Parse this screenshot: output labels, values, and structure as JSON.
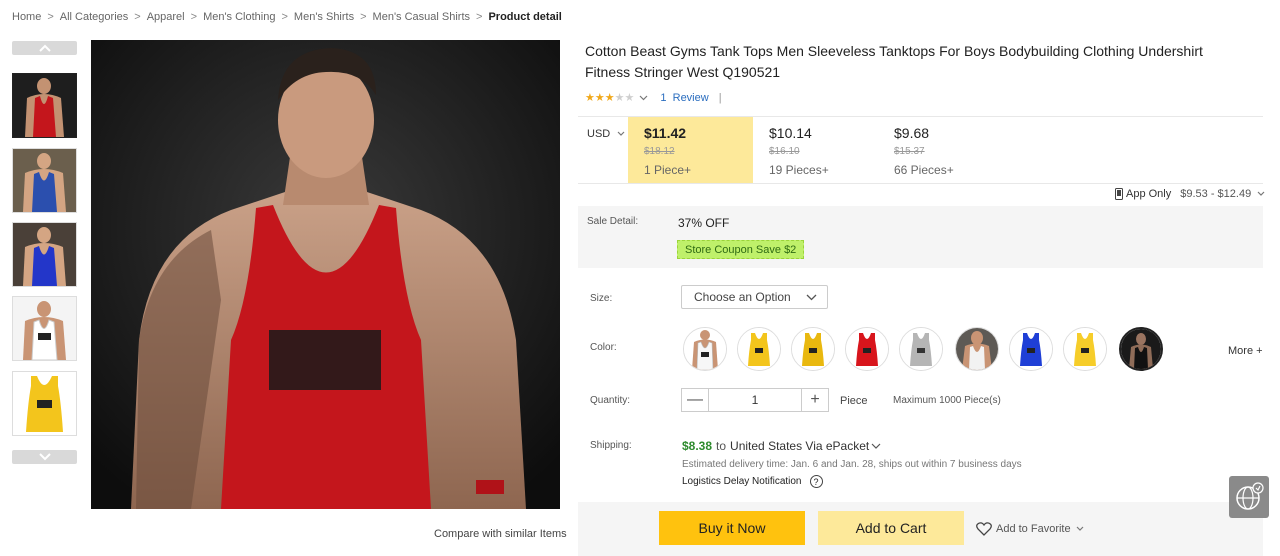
{
  "breadcrumb": [
    "Home",
    "All Categories",
    "Apparel",
    "Men's Clothing",
    "Men's Shirts",
    "Men's Casual Shirts",
    "Product detail"
  ],
  "breadcrumb_separator": ">",
  "product": {
    "title": "Cotton Beast Gyms Tank Tops Men Sleeveless Tanktops For Boys Bodybuilding Clothing Undershirt Fitness Stringer West Q190521",
    "rating_stars": 3,
    "rating_max": 5,
    "review_count": "1",
    "review_label": "Review",
    "rating_divider": "|"
  },
  "pricing": {
    "currency": "USD",
    "tiers": [
      {
        "price": "$11.42",
        "original": "$18.12",
        "quantity": "1 Piece+",
        "active": true
      },
      {
        "price": "$10.14",
        "original": "$16.10",
        "quantity": "19 Pieces+",
        "active": false
      },
      {
        "price": "$9.68",
        "original": "$15.37",
        "quantity": "66 Pieces+",
        "active": false
      }
    ],
    "app_only_label": "App Only",
    "app_only_range": "$9.53 - $12.49"
  },
  "sale": {
    "label": "Sale Detail:",
    "discount": "37% OFF",
    "coupon": "Store Coupon Save $2"
  },
  "options": {
    "size_label": "Size:",
    "size_placeholder": "Choose an Option",
    "color_label": "Color:",
    "more_label": "More +",
    "colors": [
      "white",
      "yellow",
      "yellow",
      "red",
      "gray",
      "white-photo",
      "blue",
      "yellow",
      "black"
    ]
  },
  "quantity": {
    "label": "Quantity:",
    "minus": "—",
    "value": "1",
    "plus": "+",
    "unit": "Piece",
    "max": "Maximum 1000 Piece(s)"
  },
  "shipping": {
    "label": "Shipping:",
    "price": "$8.38",
    "to": "to",
    "destination": "United States Via ePacket",
    "eta": "Estimated delivery time: Jan. 6 and Jan. 28, ships out within 7 business days",
    "logistics": "Logistics Delay Notification",
    "help": "?"
  },
  "actions": {
    "buy_now": "Buy it Now",
    "add_to_cart": "Add to Cart",
    "favorite": "Add to Favorite"
  },
  "gallery": {
    "compare": "Compare with similar Items",
    "thumb_colors": [
      "red",
      "blue",
      "blue",
      "white",
      "yellow"
    ]
  },
  "colors": {
    "active_tier_bg": "#fde99a",
    "buy_button": "#ffc20e",
    "cart_button": "#fde99a",
    "coupon_bg": "#bff06a",
    "shipping_price": "#2e8b2e",
    "link": "#2a6dbf",
    "star": "#f0a81b"
  }
}
